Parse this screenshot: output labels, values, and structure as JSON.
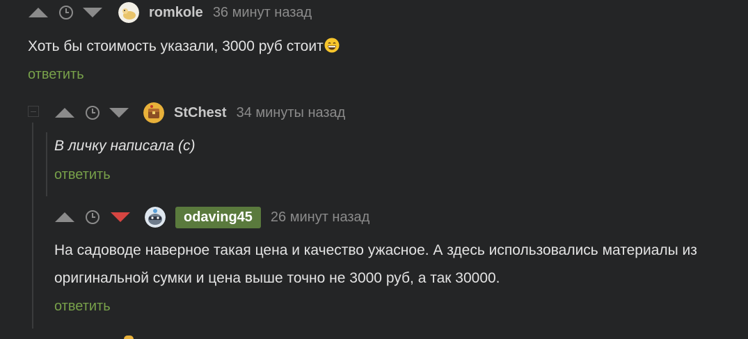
{
  "comments": [
    {
      "username": "romkole",
      "time": "36 минут назад",
      "text": "Хоть бы стоимость указали, 3000 руб стоит",
      "emoji": "grinning-face",
      "reply_label": "ответить",
      "avatar_icon": "cat-avatar",
      "vote_state": "none"
    },
    {
      "username": "StChest",
      "time": "34 минуты назад",
      "text": "В личку написала (с)",
      "reply_label": "ответить",
      "avatar_icon": "chest-avatar",
      "vote_state": "none"
    },
    {
      "username": "odaving45",
      "time": "26 минут назад",
      "text_line1": "На садоводе наверное такая цена и качество ужасное. А здесь использовались материалы из",
      "text_line2": "оригинальной сумки и цена выше точно не 3000 руб, а так 30000.",
      "reply_label": "ответить",
      "avatar_icon": "raccoon-avatar",
      "vote_state": "downvoted",
      "username_highlighted": true
    }
  ],
  "colors": {
    "background": "#242526",
    "text": "#e3e3e3",
    "muted": "#8b8b8b",
    "reply_link": "#78a14a",
    "badge": "#5a7a3d",
    "downvote_active": "#d64541",
    "vote_inactive": "#8b8b8b"
  }
}
